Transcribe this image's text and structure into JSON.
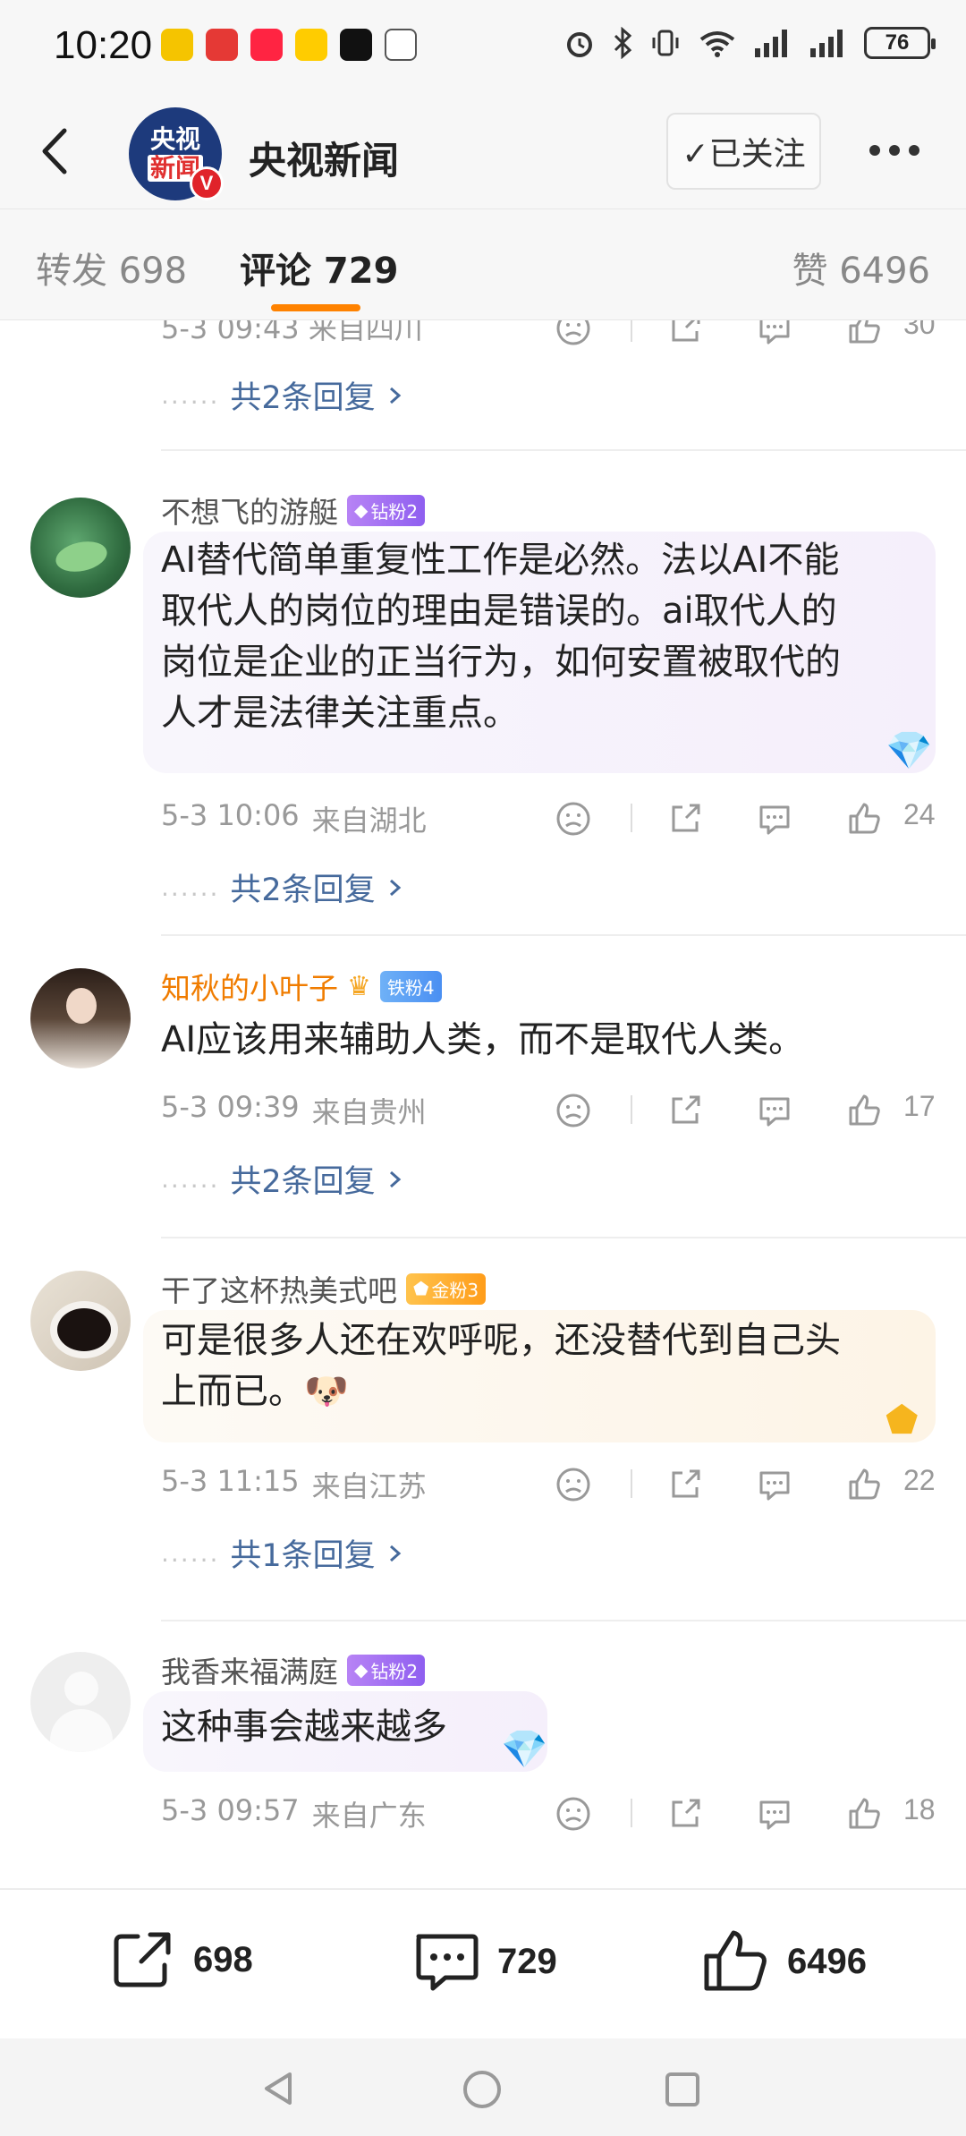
{
  "status_bar": {
    "time": "10:20",
    "battery": "76"
  },
  "header": {
    "account_name": "央视新闻",
    "follow_label": "✓已关注",
    "avatar_line1": "央视",
    "avatar_line2": "新闻",
    "verified_mark": "V"
  },
  "tabs": {
    "repost": "转发 698",
    "comment": "评论 729",
    "like": "赞 6496"
  },
  "top_partial": {
    "meta": "5-3 09:43  来自四川",
    "likes": "30",
    "replies": "共2条回复"
  },
  "comments": [
    {
      "user": "不想飞的游艇",
      "badge": "钻粉2",
      "lines": [
        "AI替代简单重复性工作是必然。法以AI不能",
        "取代人的岗位的理由是错误的。ai取代人的",
        "岗位是企业的正当行为，如何安置被取代的",
        "人才是法律关注重点。"
      ],
      "date": "5-3 10:06",
      "location": "来自湖北",
      "likes": "24",
      "replies": "共2条回复"
    },
    {
      "user": "知秋的小叶子",
      "badge": "铁粉4",
      "lines": [
        "AI应该用来辅助人类，而不是取代人类。"
      ],
      "date": "5-3 09:39",
      "location": "来自贵州",
      "likes": "17",
      "replies": "共2条回复"
    },
    {
      "user": "干了这杯热美式吧",
      "badge": "金粉3",
      "lines": [
        "可是很多人还在欢呼呢，还没替代到自己头",
        "上而已。"
      ],
      "emoji": "🐶",
      "date": "5-3 11:15",
      "location": "来自江苏",
      "likes": "22",
      "replies": "共1条回复"
    },
    {
      "user": "我香来福满庭",
      "badge": "钻粉2",
      "lines": [
        "这种事会越来越多"
      ],
      "date": "5-3 09:57",
      "location": "来自广东",
      "likes": "18"
    }
  ],
  "bottom_bar": {
    "reposts": "698",
    "comments": "729",
    "likes": "6496"
  },
  "colors": {
    "accent": "#ff8200",
    "link": "#466a9c",
    "brand_red": "#e0232a"
  },
  "icons": [
    "back-icon",
    "more-icon",
    "dislike-icon",
    "share-icon",
    "comment-icon",
    "like-icon",
    "chevron-right-icon"
  ]
}
